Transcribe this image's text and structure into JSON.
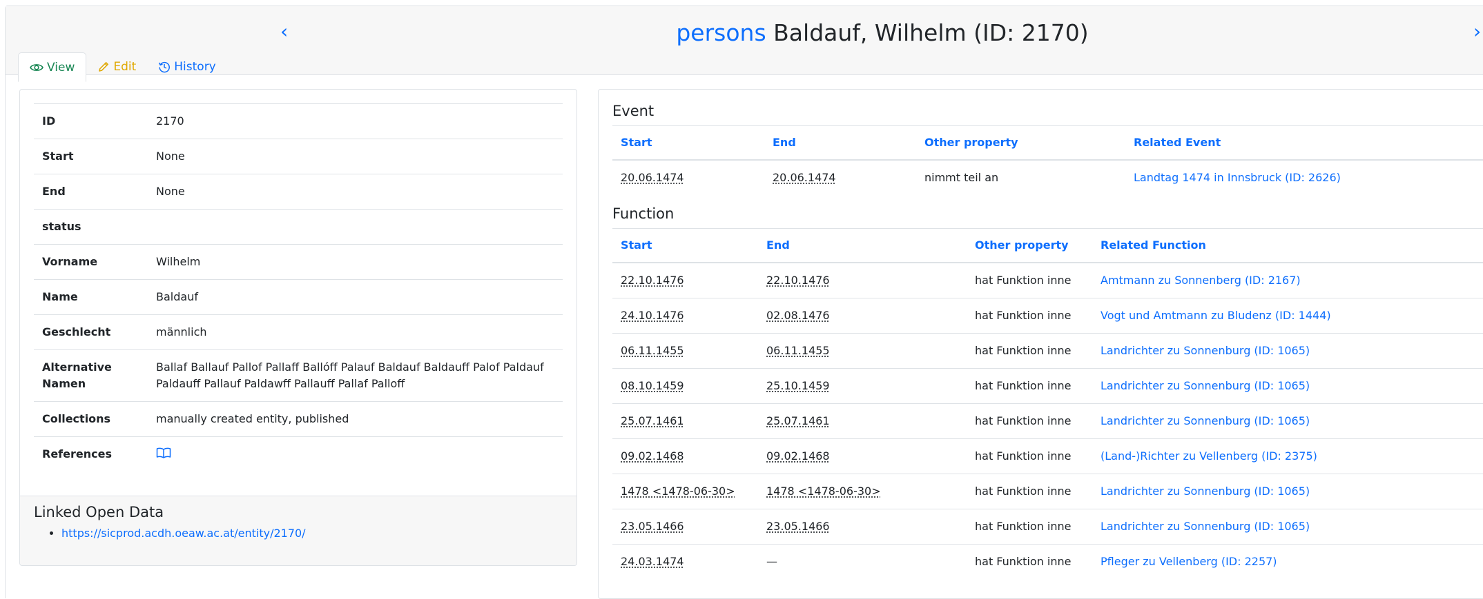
{
  "header": {
    "prev_label": "‹",
    "next_label": "›",
    "entity_type": "persons",
    "entity_title": "Baldauf, Wilhelm (ID: 2170)"
  },
  "tabs": [
    {
      "label": "View",
      "icon": "eye-icon"
    },
    {
      "label": "Edit",
      "icon": "pencil-icon"
    },
    {
      "label": "History",
      "icon": "history-icon"
    }
  ],
  "attributes": [
    {
      "key": "ID",
      "value": "2170"
    },
    {
      "key": "Start",
      "value": "None"
    },
    {
      "key": "End",
      "value": "None"
    },
    {
      "key": "status",
      "value": ""
    },
    {
      "key": "Vorname",
      "value": "Wilhelm"
    },
    {
      "key": "Name",
      "value": "Baldauf"
    },
    {
      "key": "Geschlecht",
      "value": "männlich"
    },
    {
      "key": "Alternative Namen",
      "value": "Ballaf Ballauf Pallof Pallaff Ballóff Palauf Baldauf Baldauff Palof Paldauf Paldauff Pallauf Paldawff Pallauff Pallaf Palloff"
    },
    {
      "key": "Collections",
      "value": "manually created entity, published"
    },
    {
      "key": "References",
      "value": ""
    }
  ],
  "lod": {
    "title": "Linked Open Data",
    "links": [
      "https://sicprod.acdh.oeaw.ac.at/entity/2170/"
    ]
  },
  "event": {
    "title": "Event",
    "columns": [
      "Start",
      "End",
      "Other property",
      "Related Event"
    ],
    "rows": [
      {
        "start": "20.06.1474",
        "end": "20.06.1474",
        "property": "nimmt teil an",
        "related": "Landtag 1474 in Innsbruck (ID: 2626)"
      }
    ]
  },
  "function": {
    "title": "Function",
    "columns": [
      "Start",
      "End",
      "Other property",
      "Related Function"
    ],
    "rows": [
      {
        "start": "22.10.1476",
        "end": "22.10.1476",
        "property": "hat Funktion inne",
        "related": "Amtmann zu Sonnenberg (ID: 2167)"
      },
      {
        "start": "24.10.1476",
        "end": "02.08.1476",
        "property": "hat Funktion inne",
        "related": "Vogt und Amtmann zu Bludenz (ID: 1444)"
      },
      {
        "start": "06.11.1455",
        "end": "06.11.1455",
        "property": "hat Funktion inne",
        "related": "Landrichter zu Sonnenburg (ID: 1065)"
      },
      {
        "start": "08.10.1459",
        "end": "25.10.1459",
        "property": "hat Funktion inne",
        "related": "Landrichter zu Sonnenburg (ID: 1065)"
      },
      {
        "start": "25.07.1461",
        "end": "25.07.1461",
        "property": "hat Funktion inne",
        "related": "Landrichter zu Sonnenburg (ID: 1065)"
      },
      {
        "start": "09.02.1468",
        "end": "09.02.1468",
        "property": "hat Funktion inne",
        "related": "(Land-)Richter zu Vellenberg (ID: 2375)"
      },
      {
        "start": "1478 <1478-06-30>",
        "end": "1478 <1478-06-30>",
        "property": "hat Funktion inne",
        "related": "Landrichter zu Sonnenburg (ID: 1065)"
      },
      {
        "start": "23.05.1466",
        "end": "23.05.1466",
        "property": "hat Funktion inne",
        "related": "Landrichter zu Sonnenburg (ID: 1065)"
      },
      {
        "start": "24.03.1474",
        "end": "—",
        "property": "hat Funktion inne",
        "related": "Pfleger zu Vellenberg (ID: 2257)"
      }
    ]
  },
  "colors": {
    "link": "#0d6efd",
    "view_tab": "#198754",
    "edit_tab": "#e0a800"
  }
}
